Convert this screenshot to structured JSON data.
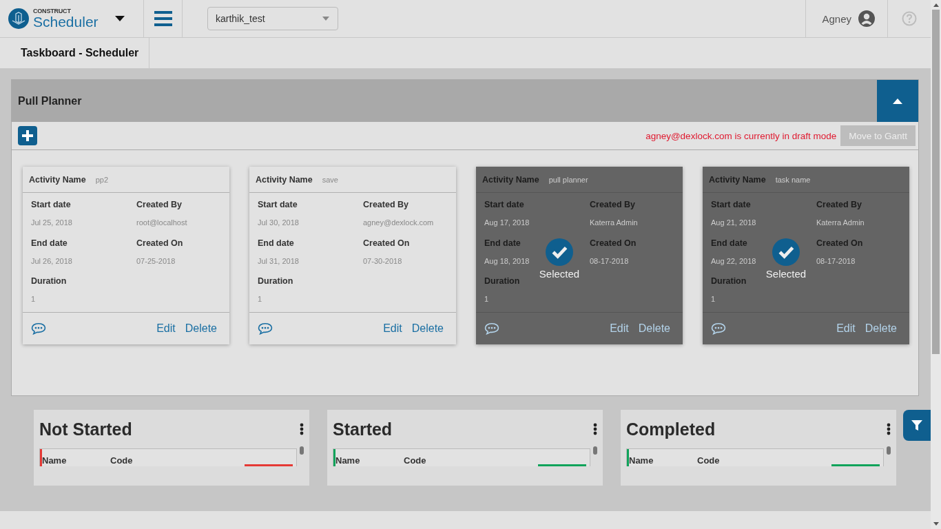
{
  "header": {
    "logo_small": "CONSTRUCT",
    "logo_large": "Scheduler",
    "project_select": {
      "value": "karthik_test"
    },
    "user": "Agney"
  },
  "tabs": [
    {
      "label": "Taskboard - Scheduler",
      "selected": true
    }
  ],
  "pull_planner": {
    "title": "Pull Planner",
    "expanded": true,
    "draft_notice": "agney@dexlock.com is currently in draft mode",
    "move_button": {
      "label": "Move to Gantt",
      "disabled": true
    },
    "cards": [
      {
        "activity_label": "Activity Name",
        "activity": "pp2",
        "selected": false,
        "fields": [
          {
            "label": "Start date",
            "value": "Jul 25, 2018"
          },
          {
            "label": "Created By",
            "value": "root@localhost"
          },
          {
            "label": "End date",
            "value": "Jul 26, 2018"
          },
          {
            "label": "Created On",
            "value": "07-25-2018"
          },
          {
            "label": "Duration",
            "value": "1"
          }
        ],
        "edit": "Edit",
        "delete": "Delete"
      },
      {
        "activity_label": "Activity Name",
        "activity": "save",
        "selected": false,
        "fields": [
          {
            "label": "Start date",
            "value": "Jul 30, 2018"
          },
          {
            "label": "Created By",
            "value": "agney@dexlock.com"
          },
          {
            "label": "End date",
            "value": "Jul 31, 2018"
          },
          {
            "label": "Created On",
            "value": "07-30-2018"
          },
          {
            "label": "Duration",
            "value": "1"
          }
        ],
        "edit": "Edit",
        "delete": "Delete"
      },
      {
        "activity_label": "Activity Name",
        "activity": "pull planner",
        "selected": true,
        "selected_label": "Selected",
        "fields": [
          {
            "label": "Start date",
            "value": "Aug 17, 2018"
          },
          {
            "label": "Created By",
            "value": "Katerra Admin"
          },
          {
            "label": "End date",
            "value": "Aug 18, 2018"
          },
          {
            "label": "Created On",
            "value": "08-17-2018"
          },
          {
            "label": "Duration",
            "value": "1"
          }
        ],
        "edit": "Edit",
        "delete": "Delete"
      },
      {
        "activity_label": "Activity Name",
        "activity": "task name",
        "selected": true,
        "selected_label": "Selected",
        "fields": [
          {
            "label": "Start date",
            "value": "Aug 21, 2018"
          },
          {
            "label": "Created By",
            "value": "Katerra Admin"
          },
          {
            "label": "End date",
            "value": "Aug 22, 2018"
          },
          {
            "label": "Created On",
            "value": "08-17-2018"
          },
          {
            "label": "Duration",
            "value": "1"
          }
        ],
        "edit": "Edit",
        "delete": "Delete"
      }
    ]
  },
  "columns": [
    {
      "title": "Not Started",
      "color": "#e53935",
      "headers": [
        "Name",
        "Code"
      ]
    },
    {
      "title": "Started",
      "color": "#0fa35a",
      "headers": [
        "Name",
        "Code"
      ]
    },
    {
      "title": "Completed",
      "color": "#0fa35a",
      "headers": [
        "Name",
        "Code"
      ]
    }
  ]
}
